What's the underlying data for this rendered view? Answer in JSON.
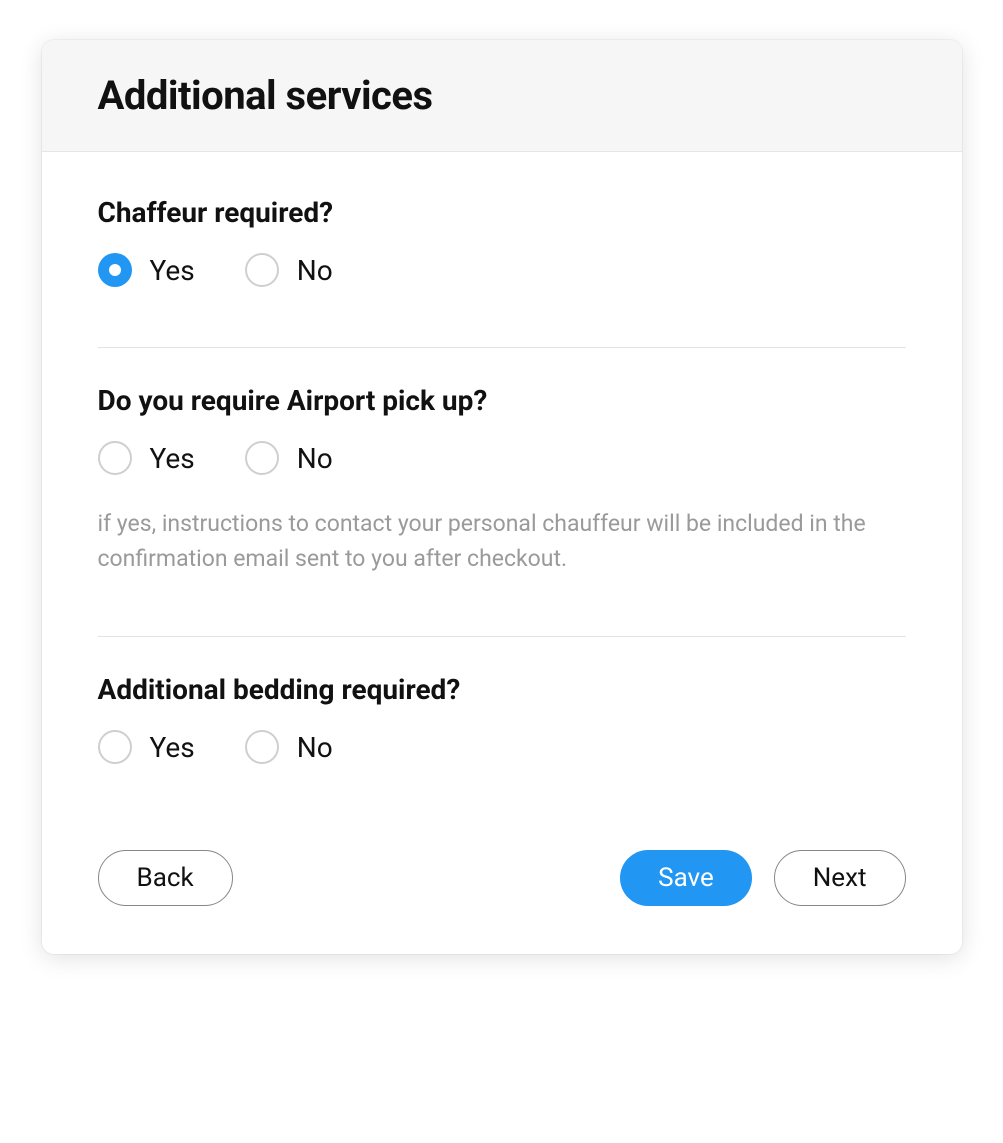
{
  "colors": {
    "accent": "#2196f3"
  },
  "header": {
    "title": "Additional services"
  },
  "questions": {
    "chauffeur": {
      "label": "Chaffeur required?",
      "yes": "Yes",
      "no": "No",
      "selected": "yes"
    },
    "airport": {
      "label": "Do you require Airport pick up?",
      "yes": "Yes",
      "no": "No",
      "helper": "if yes, instructions to contact your personal chauffeur will be included in the confirmation email sent to you after checkout."
    },
    "bedding": {
      "label": "Additional bedding required?",
      "yes": "Yes",
      "no": "No"
    }
  },
  "buttons": {
    "back": "Back",
    "save": "Save",
    "next": "Next"
  }
}
